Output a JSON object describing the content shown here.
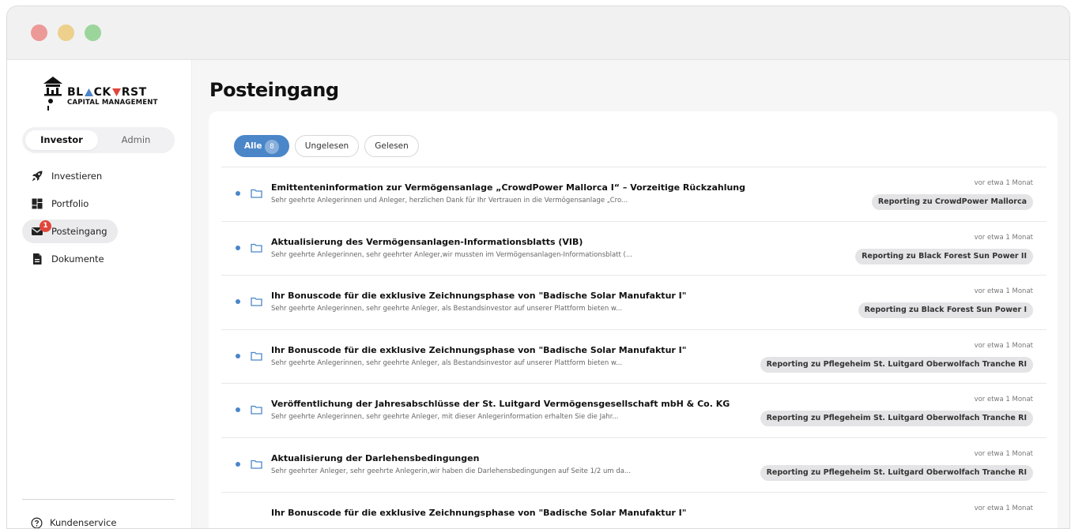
{
  "window": {
    "controls": [
      "close",
      "minimize",
      "maximize"
    ]
  },
  "brand": {
    "name_part1": "BL",
    "name_part2": "CK",
    "name_part3": "RST",
    "subtitle": "CAPITAL MANAGEMENT",
    "colors": {
      "triangle_blue": "#4a86c8",
      "triangle_red": "#e0463a"
    }
  },
  "roles": {
    "active": "Investor",
    "inactive": "Admin"
  },
  "nav": {
    "items": [
      {
        "label": "Investieren",
        "icon": "rocket-icon"
      },
      {
        "label": "Portfolio",
        "icon": "dashboard-icon"
      },
      {
        "label": "Posteingang",
        "icon": "mail-icon",
        "badge": "1",
        "active": true
      },
      {
        "label": "Dokumente",
        "icon": "document-icon"
      }
    ]
  },
  "support": {
    "label": "Kundenservice",
    "icon": "help-circle-icon"
  },
  "page": {
    "title": "Posteingang"
  },
  "filters": {
    "all": "Alle",
    "all_count": "8",
    "unread": "Ungelesen",
    "read": "Gelesen"
  },
  "messages": [
    {
      "title": "Emittenteninformation zur Vermögensanlage „CrowdPower Mallorca I“ – Vorzeitige Rückzahlung",
      "preview": "Sehr geehrte Anlegerinnen und Anleger, herzlichen Dank für Ihr Vertrauen in die Vermögensanlage „Cro...",
      "time": "vor etwa 1 Monat",
      "tag": "Reporting zu CrowdPower Mallorca"
    },
    {
      "title": "Aktualisierung des Vermögensanlagen-Informationsblatts (VIB)",
      "preview": "Sehr geehrte Anlegerinnen, sehr geehrter Anleger,wir mussten im Vermögensanlagen-Informationsblatt (...",
      "time": "vor etwa 1 Monat",
      "tag": "Reporting zu Black Forest Sun Power II"
    },
    {
      "title": "Ihr Bonuscode für die exklusive Zeichnungsphase von \"Badische Solar Manufaktur I\"",
      "preview": "Sehr geehrte Anlegerinnen, sehr geehrte Anleger, als Bestandsinvestor auf unserer Plattform bieten w...",
      "time": "vor etwa 1 Monat",
      "tag": "Reporting zu Black Forest Sun Power I"
    },
    {
      "title": "Ihr Bonuscode für die exklusive Zeichnungsphase von \"Badische Solar Manufaktur I\"",
      "preview": "Sehr geehrte Anlegerinnen, sehr geehrte Anleger, als Bestandsinvestor auf unserer Plattform bieten w...",
      "time": "vor etwa 1 Monat",
      "tag": "Reporting zu Pflegeheim St. Luitgard Oberwolfach Tranche RI"
    },
    {
      "title": "Veröffentlichung der Jahresabschlüsse der St. Luitgard Vermögensgesellschaft mbH & Co. KG",
      "preview": "Sehr geehrte Anlegerinnen, sehr geehrte Anleger, mit dieser Anlegerinformation erhalten Sie die Jahr...",
      "time": "vor etwa 1 Monat",
      "tag": "Reporting zu Pflegeheim St. Luitgard Oberwolfach Tranche RI"
    },
    {
      "title": "Aktualisierung der Darlehensbedingungen",
      "preview": "Sehr geehrter Anleger, sehr geehrte Anlegerin,wir haben die Darlehensbedingungen auf Seite 1/2 um da...",
      "time": "vor etwa 1 Monat",
      "tag": "Reporting zu Pflegeheim St. Luitgard Oberwolfach Tranche RI"
    },
    {
      "title": "Ihr Bonuscode für die exklusive Zeichnungsphase von \"Badische Solar Manufaktur I\"",
      "preview": "",
      "time": "vor etwa 1 Monat",
      "tag": ""
    }
  ]
}
